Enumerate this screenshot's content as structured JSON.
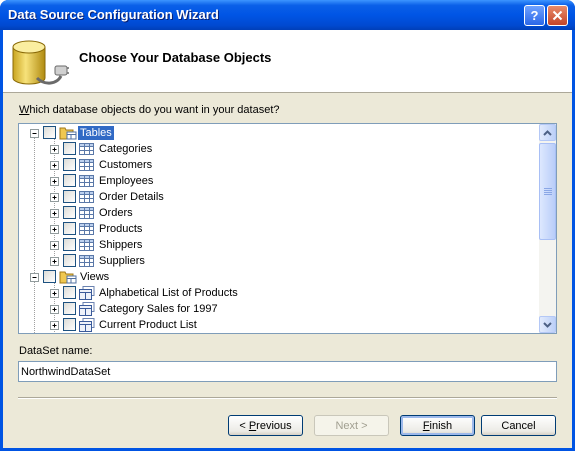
{
  "window": {
    "title": "Data Source Configuration Wizard",
    "help_glyph": "?",
    "close_glyph": "✕"
  },
  "header": {
    "title": "Choose Your Database Objects"
  },
  "prompt": {
    "accel": "W",
    "rest": "hich database objects do you want in your dataset?"
  },
  "tree": {
    "groups": [
      {
        "label": "Tables",
        "selected": true,
        "items": [
          "Categories",
          "Customers",
          "Employees",
          "Order Details",
          "Orders",
          "Products",
          "Shippers",
          "Suppliers"
        ]
      },
      {
        "label": "Views",
        "selected": false,
        "items": [
          "Alphabetical List of Products",
          "Category Sales for 1997",
          "Current Product List"
        ]
      }
    ]
  },
  "dataset": {
    "label": "DataSet name:",
    "value": "NorthwindDataSet"
  },
  "buttons": {
    "previous": {
      "prefix": "< ",
      "accel": "P",
      "rest": "revious"
    },
    "next": {
      "label": "Next >"
    },
    "finish": {
      "accel": "F",
      "rest": "inish"
    },
    "cancel": {
      "label": "Cancel"
    }
  },
  "icons": {
    "database": "database-plug-icon",
    "folder": "folder-icon",
    "table": "table-icon",
    "view": "view-icon"
  }
}
